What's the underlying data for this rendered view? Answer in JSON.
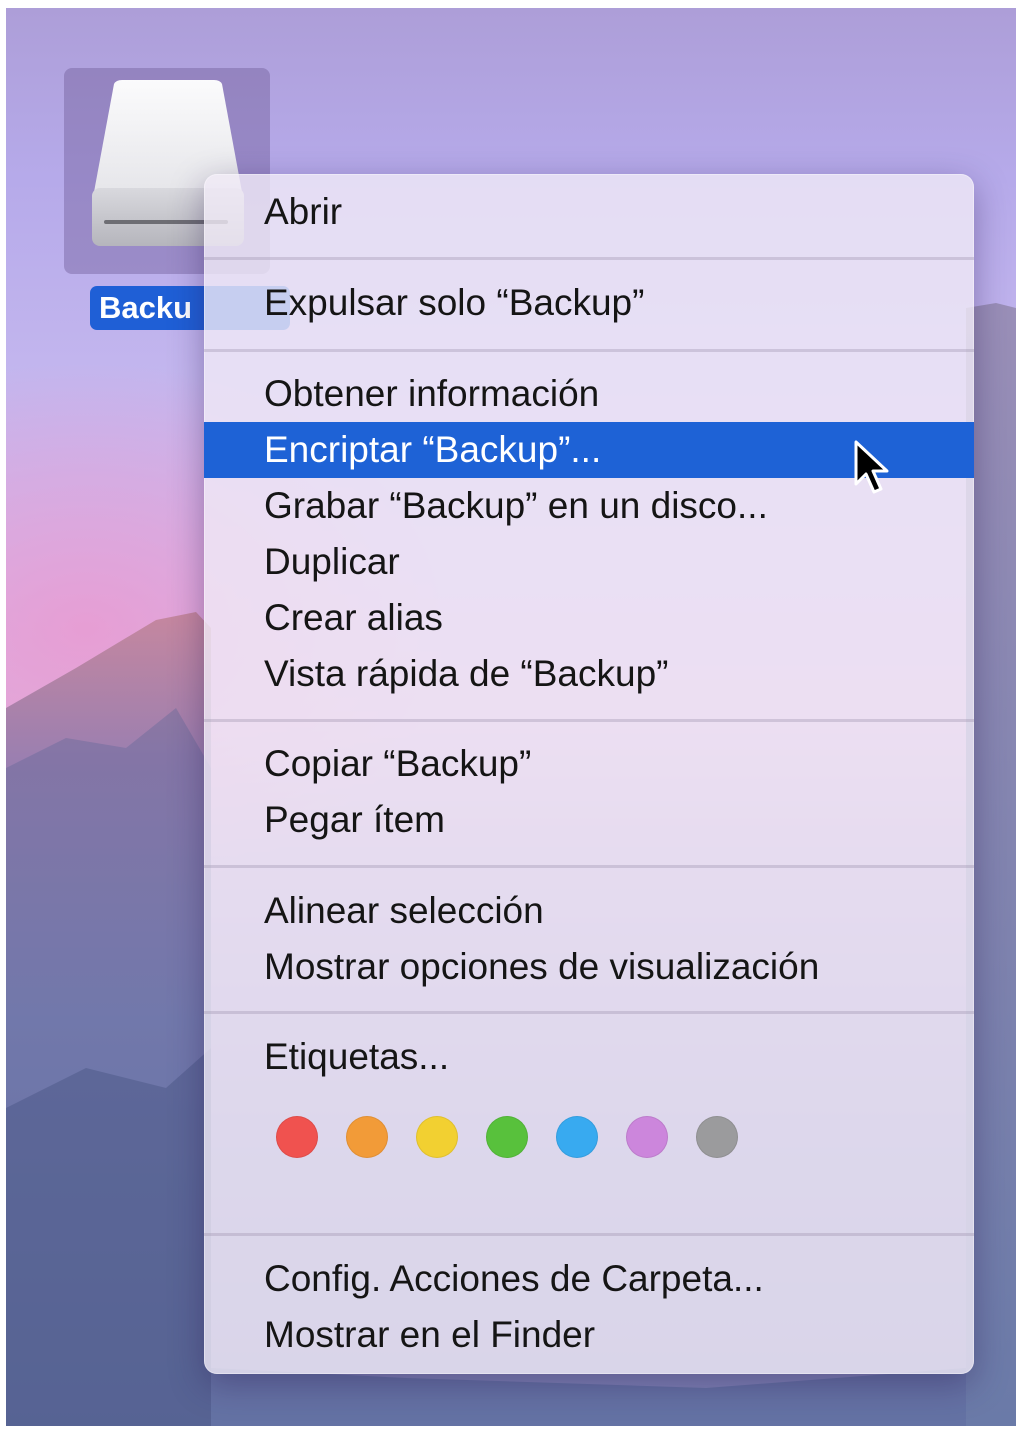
{
  "desktop": {
    "drive": {
      "label": "Backu",
      "icon": "external-drive-icon"
    }
  },
  "context_menu": {
    "highlighted_item": "Encriptar “Backup”...",
    "items": [
      {
        "label": "Abrir"
      },
      {
        "label": "Expulsar solo “Backup”"
      },
      {
        "label": "Obtener información"
      },
      {
        "label": "Encriptar “Backup”..."
      },
      {
        "label": "Grabar “Backup” en un disco..."
      },
      {
        "label": "Duplicar"
      },
      {
        "label": "Crear alias"
      },
      {
        "label": "Vista rápida de “Backup”"
      },
      {
        "label": "Copiar “Backup”"
      },
      {
        "label": "Pegar ítem"
      },
      {
        "label": "Alinear selección"
      },
      {
        "label": "Mostrar opciones de visualización"
      },
      {
        "label": "Etiquetas..."
      },
      {
        "label": "Config. Acciones de Carpeta..."
      },
      {
        "label": "Mostrar en el Finder"
      }
    ],
    "tag_colors": [
      {
        "name": "red",
        "color": "#f0524f"
      },
      {
        "name": "orange",
        "color": "#f29b38"
      },
      {
        "name": "yellow",
        "color": "#f2d031"
      },
      {
        "name": "green",
        "color": "#58c13c"
      },
      {
        "name": "blue",
        "color": "#38aaf0"
      },
      {
        "name": "purple",
        "color": "#cc86dc"
      },
      {
        "name": "gray",
        "color": "#9b9b9d"
      }
    ],
    "highlight_color": "#1e62d6"
  },
  "cursor": {
    "icon": "arrow-pointer-icon"
  }
}
